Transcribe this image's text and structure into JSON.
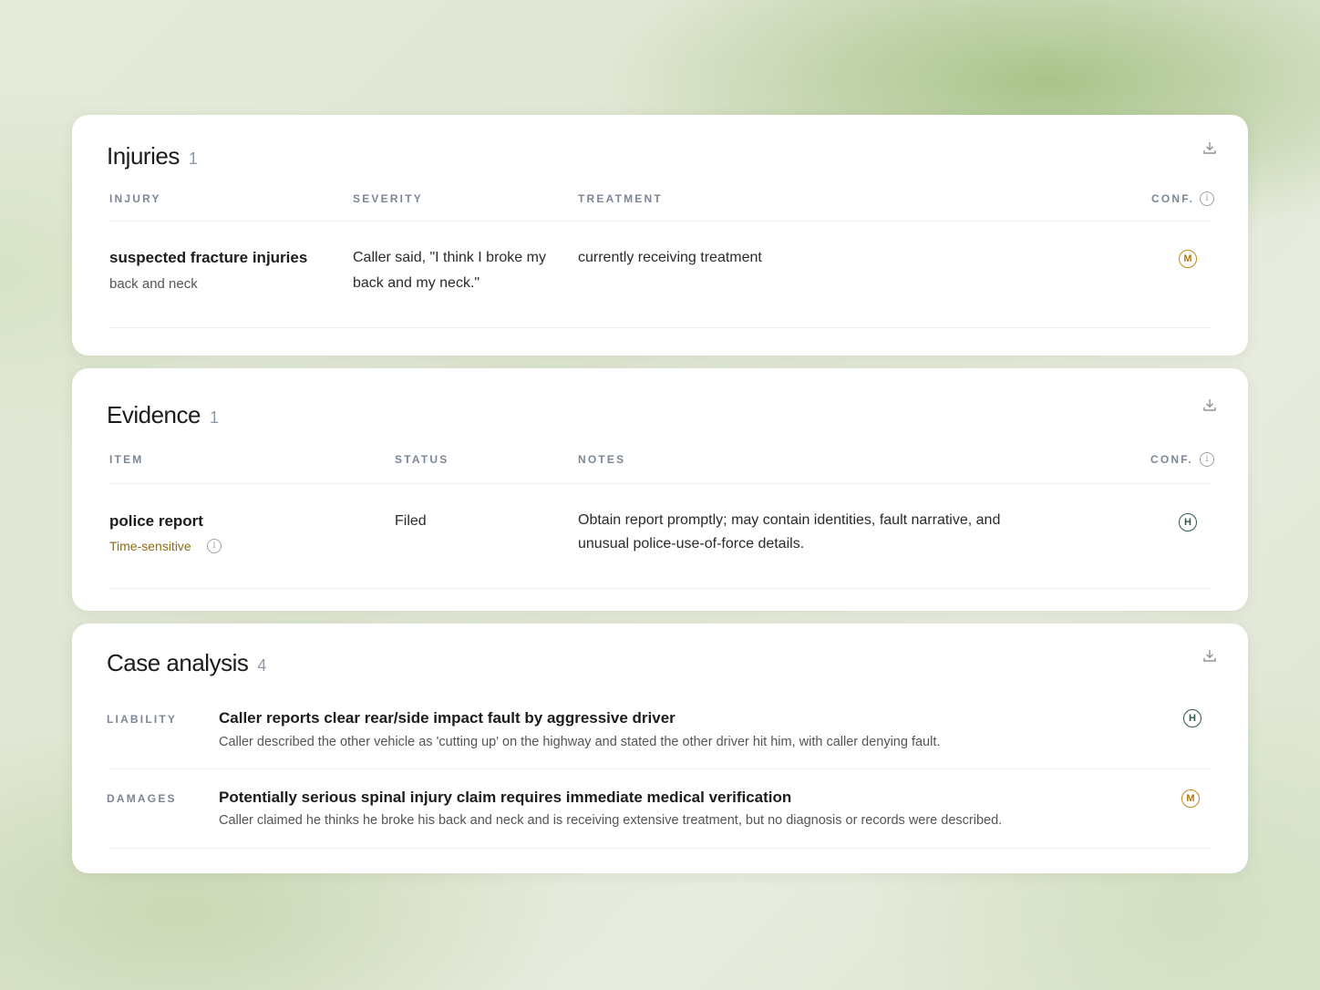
{
  "injuries": {
    "title": "Injuries",
    "count": "1",
    "headers": {
      "injury": "INJURY",
      "severity": "SEVERITY",
      "treatment": "TREATMENT",
      "conf": "CONF."
    },
    "row": {
      "injury": "suspected fracture injuries",
      "location": "back and neck",
      "severity_line1": "Caller said, \"I think I broke my",
      "severity_line2": "back and my neck.\"",
      "treatment": "currently receiving treatment",
      "conf": "M"
    }
  },
  "evidence": {
    "title": "Evidence",
    "count": "1",
    "headers": {
      "item": "ITEM",
      "status": "STATUS",
      "notes": "NOTES",
      "conf": "CONF."
    },
    "row": {
      "item": "police report",
      "tag": "Time-sensitive",
      "status": "Filed",
      "notes_line1": "Obtain report promptly; may contain identities, fault narrative, and",
      "notes_line2": "unusual police-use-of-force details.",
      "conf": "H"
    }
  },
  "case_analysis": {
    "title": "Case analysis",
    "count": "4",
    "items": [
      {
        "label": "LIABILITY",
        "title": "Caller reports clear rear/side impact fault by aggressive driver",
        "description": "Caller described the other vehicle as 'cutting up' on the highway and stated the other driver hit him, with caller denying fault.",
        "conf": "H"
      },
      {
        "label": "DAMAGES",
        "title": "Potentially serious spinal injury claim requires immediate medical verification",
        "description": "Caller claimed he thinks he broke his back and neck and is receiving extensive treatment, but no diagnosis or records were described.",
        "conf": "M"
      }
    ]
  },
  "icons": {
    "download": "download-icon",
    "info": "info-icon"
  },
  "colors": {
    "medium": "#c08a1c",
    "high": "#2f5a4a",
    "tag": "#8a6d12"
  }
}
